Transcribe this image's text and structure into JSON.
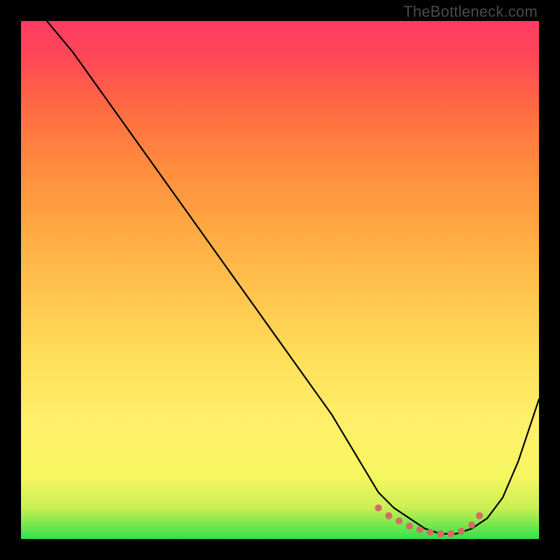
{
  "watermark": "TheBottleneck.com",
  "chart_data": {
    "type": "line",
    "title": "",
    "xlabel": "",
    "ylabel": "",
    "xlim": [
      0,
      100
    ],
    "ylim": [
      0,
      100
    ],
    "grid": false,
    "series": [
      {
        "name": "bottleneck-curve",
        "x": [
          5,
          10,
          15,
          20,
          25,
          30,
          35,
          40,
          45,
          50,
          55,
          60,
          63,
          66,
          69,
          72,
          75,
          78,
          81,
          84,
          87,
          90,
          93,
          96,
          100
        ],
        "y": [
          100,
          94,
          87,
          80,
          73,
          66,
          59,
          52,
          45,
          38,
          31,
          24,
          19,
          14,
          9,
          6,
          4,
          2,
          1,
          1,
          2,
          4,
          8,
          15,
          27
        ]
      }
    ],
    "markers": {
      "name": "trough-points",
      "color": "#d66a66",
      "radius": 5,
      "points": [
        {
          "x": 69,
          "y": 6
        },
        {
          "x": 71,
          "y": 4.5
        },
        {
          "x": 73,
          "y": 3.5
        },
        {
          "x": 75,
          "y": 2.5
        },
        {
          "x": 77,
          "y": 1.8
        },
        {
          "x": 79,
          "y": 1.3
        },
        {
          "x": 81,
          "y": 1.0
        },
        {
          "x": 83,
          "y": 1.0
        },
        {
          "x": 85,
          "y": 1.5
        },
        {
          "x": 87,
          "y": 2.7
        },
        {
          "x": 88.5,
          "y": 4.5
        }
      ]
    },
    "background_gradient": {
      "bottom": "#2fe24a",
      "mid": "#fef06a",
      "top": "#ff3a63"
    }
  }
}
